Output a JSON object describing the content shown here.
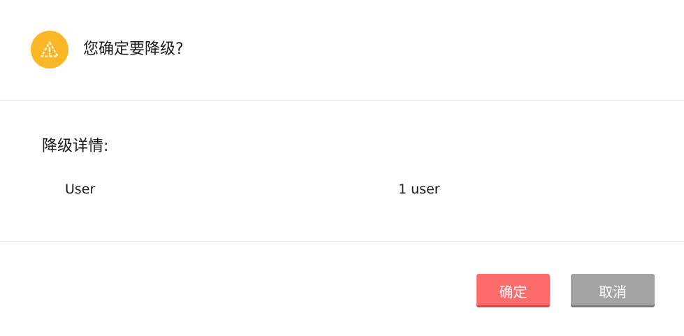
{
  "dialog": {
    "title": "您确定要降级?",
    "icon": "warning-icon",
    "accent_color": "#fbb725"
  },
  "details": {
    "heading": "降级详情:",
    "rows": [
      {
        "key": "User",
        "value": "1 user"
      }
    ]
  },
  "actions": {
    "confirm_label": "确定",
    "confirm_color": "#ff6b6b",
    "cancel_label": "取消",
    "cancel_color": "#a3a3a3"
  }
}
